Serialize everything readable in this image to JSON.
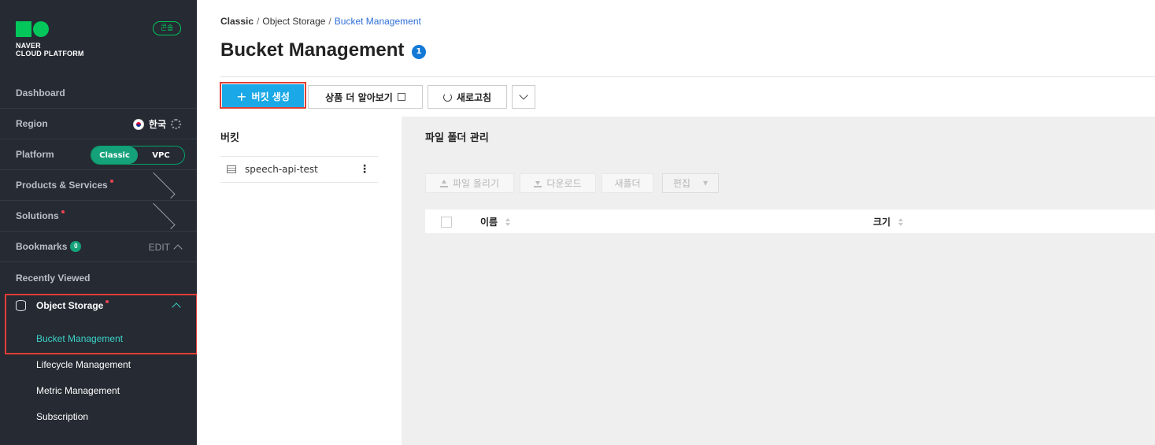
{
  "sidebar": {
    "logo_line1": "NAVER",
    "logo_line2": "CLOUD PLATFORM",
    "console_badge": "콘솔",
    "dashboard": "Dashboard",
    "region_label": "Region",
    "region_value": "한국",
    "platform_label": "Platform",
    "platform_options": [
      "Classic",
      "VPC"
    ],
    "platform_selected": "Classic",
    "products_services": "Products & Services",
    "solutions": "Solutions",
    "bookmarks": "Bookmarks",
    "bookmarks_count": "0",
    "bookmarks_edit": "EDIT",
    "recently_viewed": "Recently Viewed",
    "object_storage": "Object Storage",
    "sub_items": [
      "Bucket Management",
      "Lifecycle Management",
      "Metric Management",
      "Subscription"
    ]
  },
  "breadcrumb": [
    "Classic",
    "Object Storage",
    "Bucket Management"
  ],
  "page_title": "Bucket Management",
  "info_badge": "1",
  "toolbar": {
    "create_bucket": "버킷 생성",
    "learn_more": "상품 더 알아보기",
    "refresh": "새로고침"
  },
  "bucket_panel": {
    "title": "버킷",
    "buckets": [
      "speech-api-test"
    ]
  },
  "file_panel": {
    "title": "파일 폴더 관리",
    "upload": "파일 올리기",
    "download": "다운로드",
    "new_folder": "새폴더",
    "edit": "편집",
    "columns": [
      "이름",
      "크기"
    ]
  },
  "colors": {
    "sidebar_bg": "#252a33",
    "brand_green": "#03c75a",
    "primary_button": "#1aa8e6",
    "active_teal": "#3cd4c9",
    "highlight_red": "#e03e36"
  }
}
